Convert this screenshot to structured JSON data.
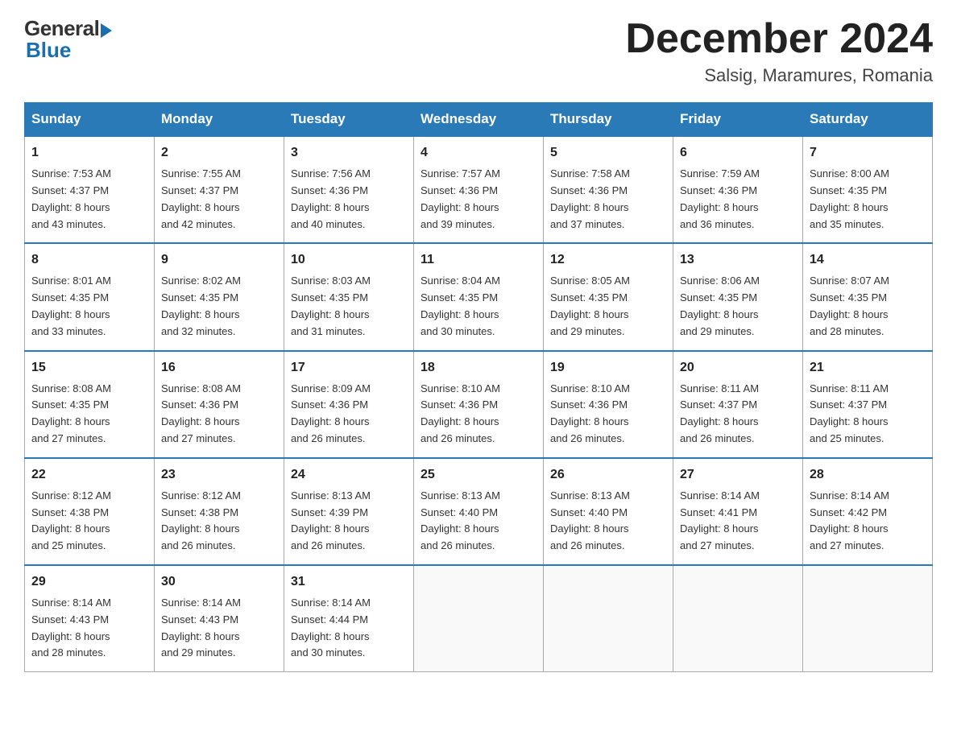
{
  "logo": {
    "general": "General",
    "blue": "Blue"
  },
  "title": {
    "month": "December 2024",
    "location": "Salsig, Maramures, Romania"
  },
  "days_of_week": [
    "Sunday",
    "Monday",
    "Tuesday",
    "Wednesday",
    "Thursday",
    "Friday",
    "Saturday"
  ],
  "weeks": [
    [
      {
        "day": "1",
        "sunrise": "7:53 AM",
        "sunset": "4:37 PM",
        "daylight": "8 hours and 43 minutes."
      },
      {
        "day": "2",
        "sunrise": "7:55 AM",
        "sunset": "4:37 PM",
        "daylight": "8 hours and 42 minutes."
      },
      {
        "day": "3",
        "sunrise": "7:56 AM",
        "sunset": "4:36 PM",
        "daylight": "8 hours and 40 minutes."
      },
      {
        "day": "4",
        "sunrise": "7:57 AM",
        "sunset": "4:36 PM",
        "daylight": "8 hours and 39 minutes."
      },
      {
        "day": "5",
        "sunrise": "7:58 AM",
        "sunset": "4:36 PM",
        "daylight": "8 hours and 37 minutes."
      },
      {
        "day": "6",
        "sunrise": "7:59 AM",
        "sunset": "4:36 PM",
        "daylight": "8 hours and 36 minutes."
      },
      {
        "day": "7",
        "sunrise": "8:00 AM",
        "sunset": "4:35 PM",
        "daylight": "8 hours and 35 minutes."
      }
    ],
    [
      {
        "day": "8",
        "sunrise": "8:01 AM",
        "sunset": "4:35 PM",
        "daylight": "8 hours and 33 minutes."
      },
      {
        "day": "9",
        "sunrise": "8:02 AM",
        "sunset": "4:35 PM",
        "daylight": "8 hours and 32 minutes."
      },
      {
        "day": "10",
        "sunrise": "8:03 AM",
        "sunset": "4:35 PM",
        "daylight": "8 hours and 31 minutes."
      },
      {
        "day": "11",
        "sunrise": "8:04 AM",
        "sunset": "4:35 PM",
        "daylight": "8 hours and 30 minutes."
      },
      {
        "day": "12",
        "sunrise": "8:05 AM",
        "sunset": "4:35 PM",
        "daylight": "8 hours and 29 minutes."
      },
      {
        "day": "13",
        "sunrise": "8:06 AM",
        "sunset": "4:35 PM",
        "daylight": "8 hours and 29 minutes."
      },
      {
        "day": "14",
        "sunrise": "8:07 AM",
        "sunset": "4:35 PM",
        "daylight": "8 hours and 28 minutes."
      }
    ],
    [
      {
        "day": "15",
        "sunrise": "8:08 AM",
        "sunset": "4:35 PM",
        "daylight": "8 hours and 27 minutes."
      },
      {
        "day": "16",
        "sunrise": "8:08 AM",
        "sunset": "4:36 PM",
        "daylight": "8 hours and 27 minutes."
      },
      {
        "day": "17",
        "sunrise": "8:09 AM",
        "sunset": "4:36 PM",
        "daylight": "8 hours and 26 minutes."
      },
      {
        "day": "18",
        "sunrise": "8:10 AM",
        "sunset": "4:36 PM",
        "daylight": "8 hours and 26 minutes."
      },
      {
        "day": "19",
        "sunrise": "8:10 AM",
        "sunset": "4:36 PM",
        "daylight": "8 hours and 26 minutes."
      },
      {
        "day": "20",
        "sunrise": "8:11 AM",
        "sunset": "4:37 PM",
        "daylight": "8 hours and 26 minutes."
      },
      {
        "day": "21",
        "sunrise": "8:11 AM",
        "sunset": "4:37 PM",
        "daylight": "8 hours and 25 minutes."
      }
    ],
    [
      {
        "day": "22",
        "sunrise": "8:12 AM",
        "sunset": "4:38 PM",
        "daylight": "8 hours and 25 minutes."
      },
      {
        "day": "23",
        "sunrise": "8:12 AM",
        "sunset": "4:38 PM",
        "daylight": "8 hours and 26 minutes."
      },
      {
        "day": "24",
        "sunrise": "8:13 AM",
        "sunset": "4:39 PM",
        "daylight": "8 hours and 26 minutes."
      },
      {
        "day": "25",
        "sunrise": "8:13 AM",
        "sunset": "4:40 PM",
        "daylight": "8 hours and 26 minutes."
      },
      {
        "day": "26",
        "sunrise": "8:13 AM",
        "sunset": "4:40 PM",
        "daylight": "8 hours and 26 minutes."
      },
      {
        "day": "27",
        "sunrise": "8:14 AM",
        "sunset": "4:41 PM",
        "daylight": "8 hours and 27 minutes."
      },
      {
        "day": "28",
        "sunrise": "8:14 AM",
        "sunset": "4:42 PM",
        "daylight": "8 hours and 27 minutes."
      }
    ],
    [
      {
        "day": "29",
        "sunrise": "8:14 AM",
        "sunset": "4:43 PM",
        "daylight": "8 hours and 28 minutes."
      },
      {
        "day": "30",
        "sunrise": "8:14 AM",
        "sunset": "4:43 PM",
        "daylight": "8 hours and 29 minutes."
      },
      {
        "day": "31",
        "sunrise": "8:14 AM",
        "sunset": "4:44 PM",
        "daylight": "8 hours and 30 minutes."
      },
      null,
      null,
      null,
      null
    ]
  ],
  "labels": {
    "sunrise": "Sunrise:",
    "sunset": "Sunset:",
    "daylight": "Daylight:"
  }
}
